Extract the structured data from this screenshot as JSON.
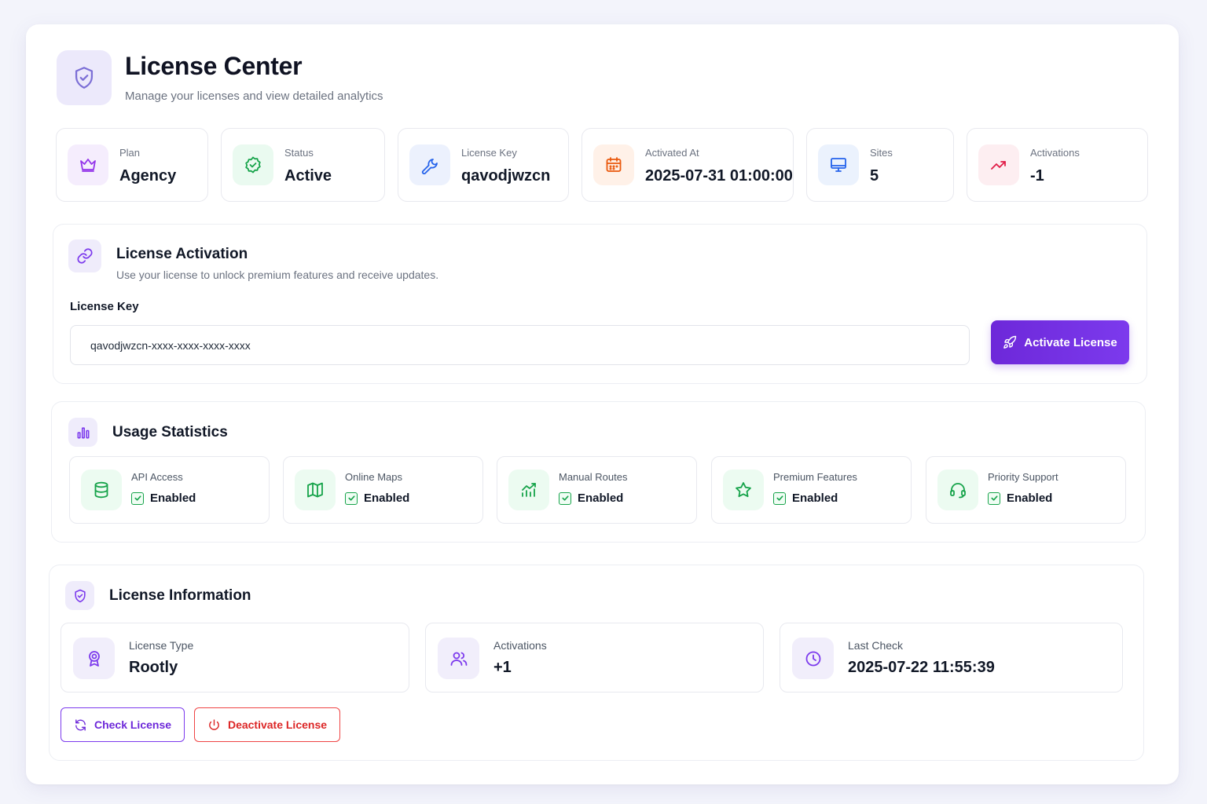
{
  "header": {
    "title": "License Center",
    "subtitle": "Manage your licenses and view detailed analytics",
    "icon": "shield-check-icon"
  },
  "stats": [
    {
      "label": "Plan",
      "value": "Agency",
      "icon": "crown-icon",
      "color": "#9333ea"
    },
    {
      "label": "Status",
      "value": "Active",
      "icon": "badge-check-icon",
      "color": "#16a34a"
    },
    {
      "label": "License Key",
      "value": "qavodjwzcn",
      "icon": "wrench-icon",
      "color": "#2563eb"
    },
    {
      "label": "Activated At",
      "value": "2025-07-31 01:00:00",
      "icon": "calendar-icon",
      "color": "#ea580c"
    },
    {
      "label": "Sites",
      "value": "5",
      "icon": "monitor-icon",
      "color": "#2563eb"
    },
    {
      "label": "Activations",
      "value": "-1",
      "icon": "trending-up-icon",
      "color": "#e11d48"
    }
  ],
  "activation": {
    "title": "License Activation",
    "subtitle": "Use your license to unlock premium features and receive updates.",
    "field_label": "License Key",
    "input_value": "qavodjwzcn-xxxx-xxxx-xxxx-xxxx",
    "button_label": "Activate License"
  },
  "usage": {
    "title": "Usage Statistics",
    "features": [
      {
        "label": "API Access",
        "status": "Enabled",
        "icon": "database-icon"
      },
      {
        "label": "Online Maps",
        "status": "Enabled",
        "icon": "map-icon"
      },
      {
        "label": "Manual Routes",
        "status": "Enabled",
        "icon": "chart-growth-icon"
      },
      {
        "label": "Premium Features",
        "status": "Enabled",
        "icon": "star-icon"
      },
      {
        "label": "Priority Support",
        "status": "Enabled",
        "icon": "headset-icon"
      }
    ]
  },
  "info": {
    "title": "License Information",
    "cards": [
      {
        "label": "License Type",
        "value": "Rootly",
        "icon": "award-icon"
      },
      {
        "label": "Activations",
        "value": "+1",
        "icon": "users-icon"
      },
      {
        "label": "Last Check",
        "value": "2025-07-22 11:55:39",
        "icon": "clock-icon"
      }
    ],
    "check_button": "Check License",
    "deactivate_button": "Deactivate License"
  },
  "colors": {
    "accent": "#6d28d9",
    "success": "#16a34a",
    "danger": "#dc2626"
  }
}
